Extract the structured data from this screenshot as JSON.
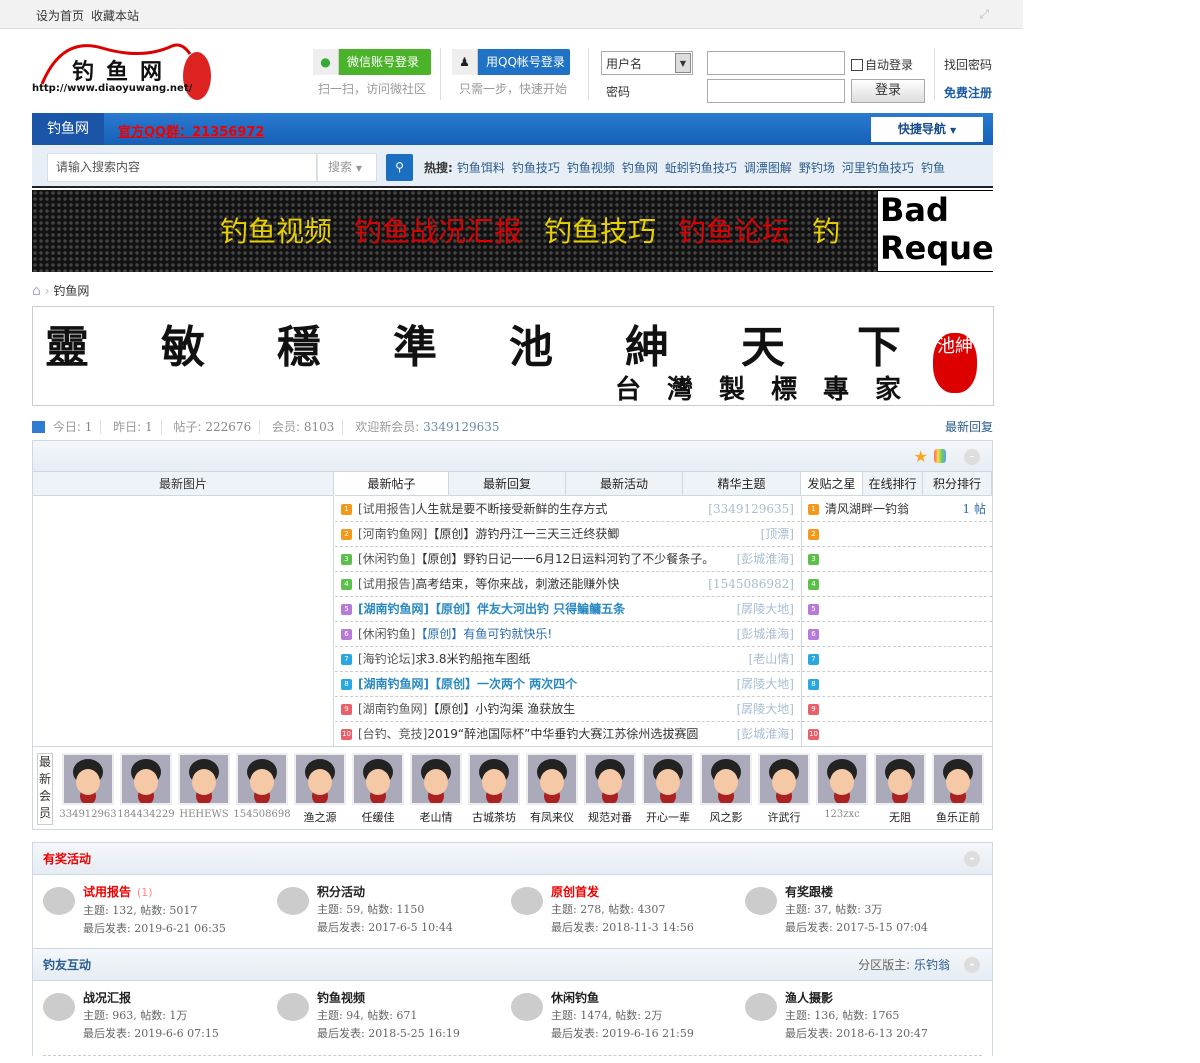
{
  "topbar": {
    "links": [
      "设为首页",
      "收藏本站"
    ]
  },
  "logo": {
    "title": "钓鱼网",
    "url": "http://www.diaoyuwang.net/"
  },
  "login": {
    "wechat": "微信账号登录",
    "wechat_sub": "扫一扫，访问微社区",
    "qq": "用QQ帐号登录",
    "qq_sub": "只需一步，快速开始",
    "user_select": "用户名",
    "password_label": "密码",
    "auto_login": "自动登录",
    "submit": "登录",
    "forgot": "找回密码",
    "register": "免费注册"
  },
  "nav": {
    "home": "钓鱼网",
    "qq_group": "官方QQ群：21356972",
    "quick": "快捷导航"
  },
  "search": {
    "placeholder": "请输入搜索内容",
    "type": "搜索",
    "hot_label": "热搜:",
    "hot": [
      "钓鱼饵料",
      "钓鱼技巧",
      "钓鱼视频",
      "钓鱼网",
      "蚯蚓钓鱼技巧",
      "调漂图解",
      "野钓场",
      "河里钓鱼技巧",
      "钓鱼"
    ]
  },
  "banner": {
    "items": [
      {
        "t": "钓鱼视频",
        "c": "#e8d000"
      },
      {
        "t": "钓鱼战况汇报",
        "c": "#d00"
      },
      {
        "t": "钓鱼技巧",
        "c": "#e8d000"
      },
      {
        "t": "钓鱼论坛",
        "c": "#d00"
      },
      {
        "t": "钓",
        "c": "#e8d000"
      }
    ],
    "broken": "Bad Reque"
  },
  "breadcrumb": {
    "current": "钓鱼网"
  },
  "ad": {
    "calligraphy": "靈敏穩準池紳天下",
    "tagline": "台灣製標專家",
    "seal": "池紳"
  },
  "stats": {
    "today_label": "今日:",
    "today": "1",
    "yesterday_label": "昨日:",
    "yesterday": "1",
    "posts_label": "帖子:",
    "posts": "222676",
    "members_label": "会员:",
    "members": "8103",
    "welcome_label": "欢迎新会员:",
    "newest": "3349129635",
    "latest_reply": "最新回复"
  },
  "box": {
    "pictures_tab": "最新图片",
    "tabs": [
      "最新帖子",
      "最新回复",
      "最新活动",
      "精华主题"
    ],
    "rank_tabs": [
      "发贴之星",
      "在线排行",
      "积分排行"
    ],
    "posts": [
      {
        "cat": "[试用报告]",
        "title": "人生就是要不断接受新鲜的生存方式",
        "author": "[3349129635]",
        "color": "#f39a1c",
        "hl": false
      },
      {
        "cat": "[河南钓鱼网]",
        "title": "【原创】游钓丹江一三天三迁终获鲫",
        "author": "[顶漂]",
        "color": "#f39a1c",
        "hl": false
      },
      {
        "cat": "[休闲钓鱼]",
        "title": "【原创】野钓日记一一6月12日运料河钓了不少餐条子。",
        "author": "[彭城淮海]",
        "color": "#5cbf4a",
        "hl": false
      },
      {
        "cat": "[试用报告]",
        "title": "高考结束，等你来战，刺激还能赚外快",
        "author": "[1545086982]",
        "color": "#5cbf4a",
        "hl": false
      },
      {
        "cat": "[湖南钓鱼网]",
        "title": "【原创】伴友大河出钓 只得鳊鳙五条",
        "author": "[孱陵大地]",
        "color": "#b77ad8",
        "hl": true
      },
      {
        "cat": "[休闲钓鱼]",
        "title": "【原创】有鱼可钓就快乐!",
        "author": "[彭城淮海]",
        "color": "#b77ad8",
        "hl": false,
        "blue": true
      },
      {
        "cat": "[海钓论坛]",
        "title": "求3.8米钓船拖车图纸",
        "author": "[老山情]",
        "color": "#2aa6e0",
        "hl": false
      },
      {
        "cat": "[湖南钓鱼网]",
        "title": "【原创】一次两个 两次四个",
        "author": "[孱陵大地]",
        "color": "#2aa6e0",
        "hl": true
      },
      {
        "cat": "[湖南钓鱼网]",
        "title": "【原创】小钓沟渠 渔获放生",
        "author": "[孱陵大地]",
        "color": "#e9606a",
        "hl": false
      },
      {
        "cat": "[台钓、竞技]",
        "title": "2019“醉池国际杯”中华垂钓大赛江苏徐州选拔赛圆",
        "author": "[彭城淮海]",
        "color": "#e9606a",
        "hl": false
      }
    ],
    "rank": [
      {
        "name": "清风湖畔一钓翁",
        "count": "1 帖"
      }
    ],
    "members_label": "最新会员",
    "members": [
      "334912963",
      "184434229",
      "HEHEWS",
      "154508698",
      "渔之源",
      "任缓佳",
      "老山情",
      "古城茶坊",
      "有凤来仪",
      "规范对番",
      "开心一辈",
      "风之影",
      "许武行",
      "123zxc",
      "无阻",
      "鱼乐正前"
    ]
  },
  "sections": [
    {
      "title": "有奖活动",
      "title_color": "#e00",
      "moderator_label": "",
      "moderator": "",
      "forums": [
        {
          "name": "试用报告",
          "count": "(1)",
          "red": true,
          "topics": "主题: 132, 帖数: 5017",
          "last": "最后发表: 2019-6-21 06:35"
        },
        {
          "name": "积分活动",
          "count": "",
          "red": false,
          "topics": "主题: 59, 帖数: 1150",
          "last": "最后发表: 2017-6-5 10:44"
        },
        {
          "name": "原创首发",
          "count": "",
          "red": true,
          "topics": "主题: 278, 帖数: 4307",
          "last": "最后发表: 2018-11-3 14:56"
        },
        {
          "name": "有奖跟楼",
          "count": "",
          "red": false,
          "topics": "主题: 37, 帖数: 3万",
          "last": "最后发表: 2017-5-15 07:04"
        }
      ]
    },
    {
      "title": "钓友互动",
      "title_color": "#2b5c8e",
      "moderator_label": "分区版主:",
      "moderator": "乐钓翁",
      "forums": [
        {
          "name": "战况汇报",
          "count": "",
          "red": false,
          "topics": "主题: 963, 帖数: 1万",
          "last": "最后发表: 2019-6-6 07:15"
        },
        {
          "name": "钓鱼视频",
          "count": "",
          "red": false,
          "topics": "主题: 94, 帖数: 671",
          "last": "最后发表: 2018-5-25 16:19"
        },
        {
          "name": "休闲钓鱼",
          "count": "",
          "red": false,
          "topics": "主题: 1474, 帖数: 2万",
          "last": "最后发表: 2019-6-16 21:59"
        },
        {
          "name": "渔人摄影",
          "count": "",
          "red": false,
          "topics": "主题: 136, 帖数: 1765",
          "last": "最后发表: 2018-6-13 20:47"
        }
      ]
    }
  ]
}
